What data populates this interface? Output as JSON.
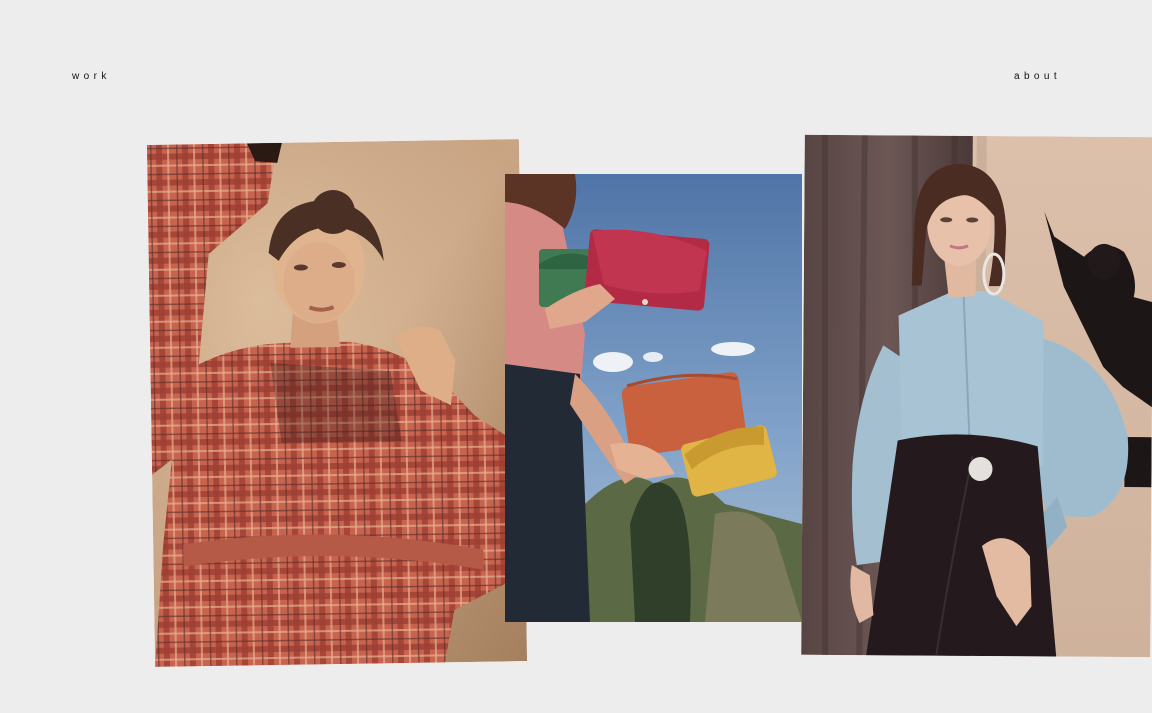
{
  "nav": {
    "work_label": "work",
    "about_label": "about"
  },
  "gallery": {
    "items": [
      {
        "icon": "photo-model-plaid-coat"
      },
      {
        "icon": "photo-leather-clutches-sky"
      },
      {
        "icon": "photo-model-blue-shirt"
      }
    ]
  },
  "colors": {
    "background": "#ededee",
    "text": "#111111"
  }
}
